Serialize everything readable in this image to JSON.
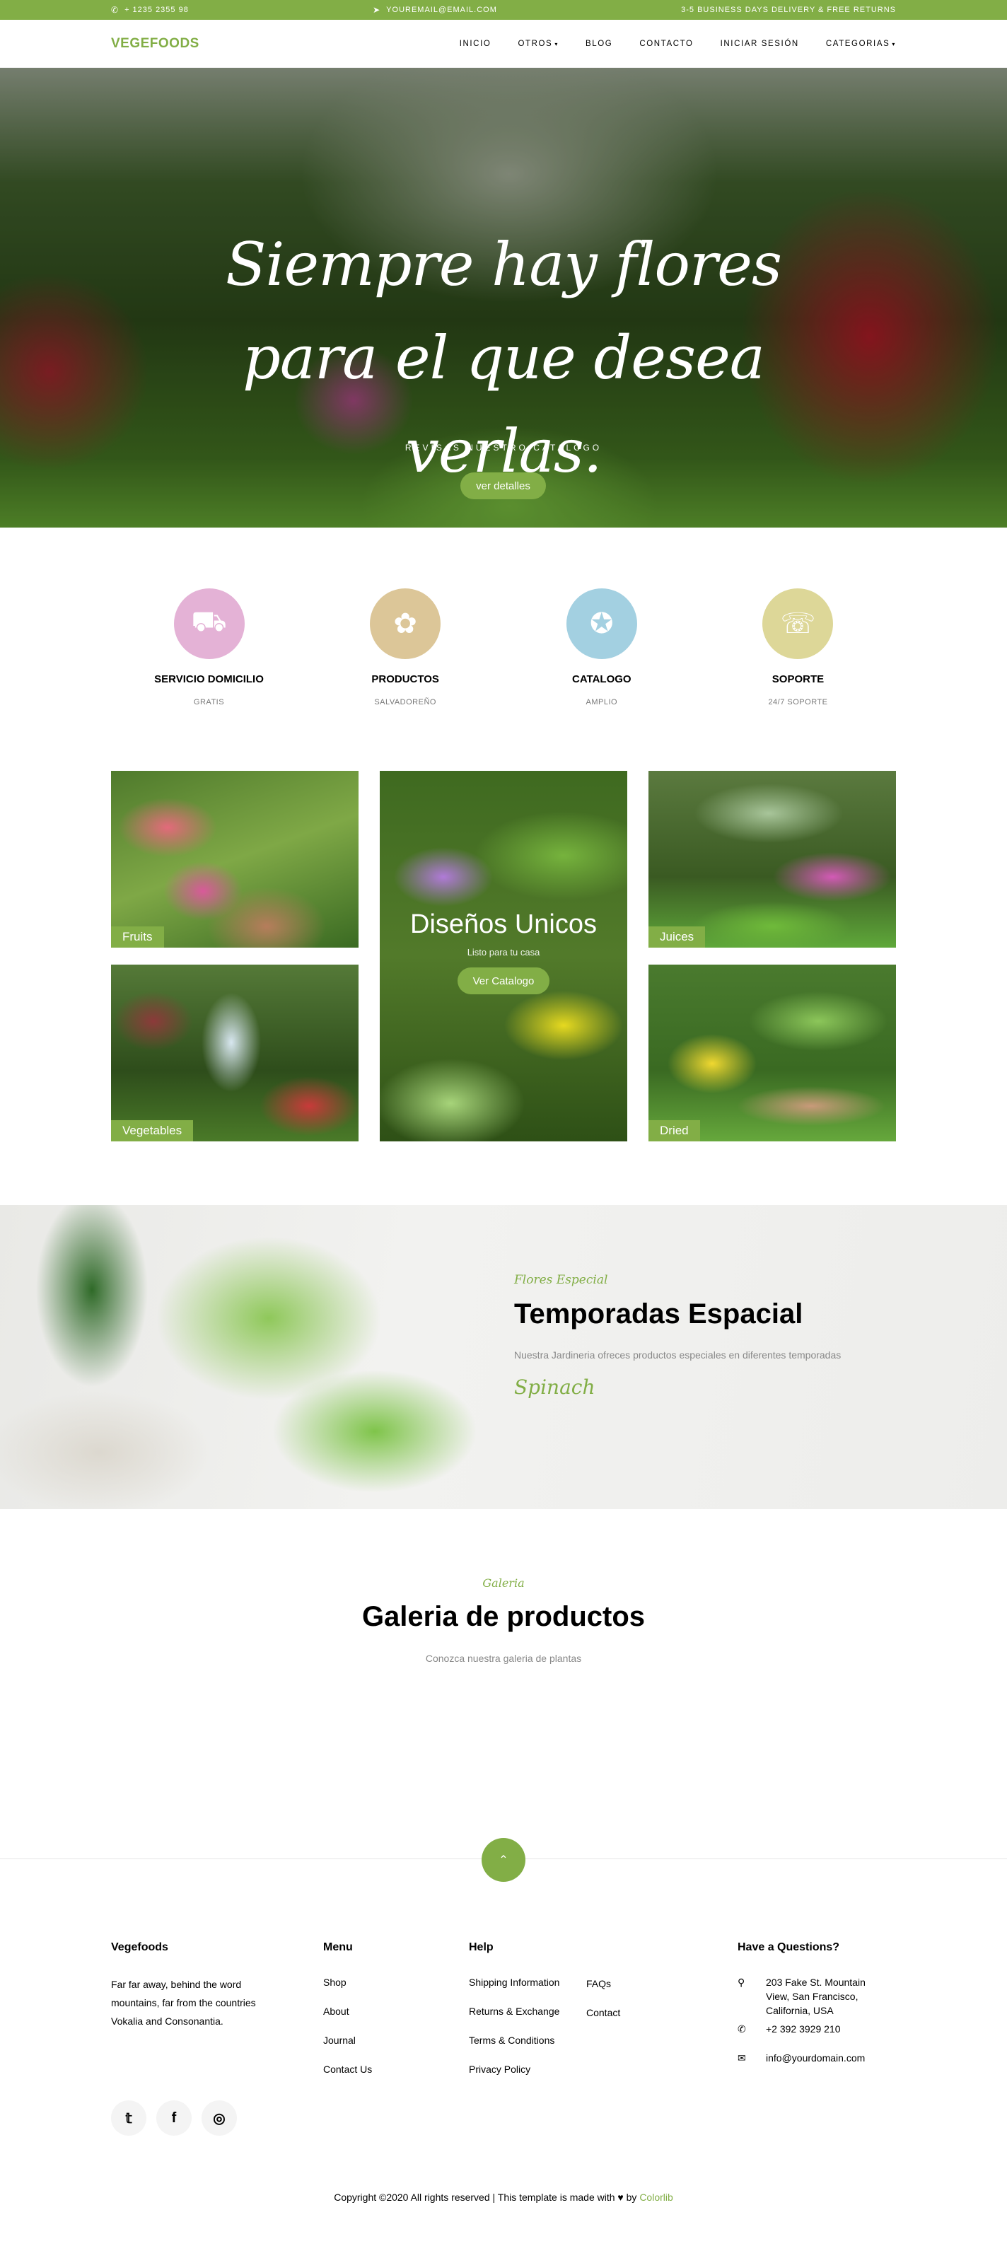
{
  "topbar": {
    "phone": "+ 1235 2355 98",
    "email": "YOUREMAIL@EMAIL.COM",
    "promo": "3-5 BUSINESS DAYS DELIVERY & FREE RETURNS"
  },
  "navbar": {
    "brand": "VEGEFOODS",
    "items": [
      {
        "label": "INICIO",
        "dropdown": false
      },
      {
        "label": "OTROS",
        "dropdown": true
      },
      {
        "label": "BLOG",
        "dropdown": false
      },
      {
        "label": "CONTACTO",
        "dropdown": false
      },
      {
        "label": "INICIAR SESIÓN",
        "dropdown": false
      },
      {
        "label": "CATEGORIAS",
        "dropdown": true
      }
    ]
  },
  "hero": {
    "title": "Siempre hay flores para el que desea verlas.",
    "subtitle": "REVISAS NUESTRO CATALOGO",
    "button": "ver detalles"
  },
  "services": [
    {
      "title": "SERVICIO DOMICILIO",
      "desc": "GRATIS",
      "icon": "truck-icon",
      "color": "#e4b2d6"
    },
    {
      "title": "PRODUCTOS",
      "desc": "SALVADOREÑO",
      "icon": "flower-pot-icon",
      "color": "#dcc698"
    },
    {
      "title": "CATALOGO",
      "desc": "AMPLIO",
      "icon": "award-icon",
      "color": "#a3d0e1"
    },
    {
      "title": "SOPORTE",
      "desc": "24/7 SOPORTE",
      "icon": "support-icon",
      "color": "#ddd798"
    }
  ],
  "categories": {
    "tiles": [
      {
        "label": "Fruits"
      },
      {
        "label": "Juices"
      },
      {
        "label": "Vegetables"
      },
      {
        "label": "Dried"
      }
    ],
    "center": {
      "title": "Diseños Unicos",
      "tagline": "Listo para tu casa",
      "button": "Ver Catalogo"
    }
  },
  "special": {
    "kicker": "Flores Especial",
    "title": "Temporadas Espacial",
    "text": "Nuestra Jardineria ofreces productos especiales en diferentes temporadas",
    "product": "Spinach"
  },
  "gallery": {
    "kicker": "Galeria",
    "title": "Galeria de productos",
    "text": "Conozca nuestra galeria de plantas"
  },
  "footer": {
    "about": {
      "title": "Vegefoods",
      "text": "Far far away, behind the word mountains, far from the countries Vokalia and Consonantia."
    },
    "menu": {
      "title": "Menu",
      "items": [
        "Shop",
        "About",
        "Journal",
        "Contact Us"
      ]
    },
    "help": {
      "title": "Help",
      "col1": [
        "Shipping Information",
        "Returns & Exchange",
        "Terms & Conditions",
        "Privacy Policy"
      ],
      "col2": [
        "FAQs",
        "Contact"
      ]
    },
    "contact": {
      "title": "Have a Questions?",
      "address": "203 Fake St. Mountain View, San Francisco, California, USA",
      "phone": "+2 392 3929 210",
      "email": "info@yourdomain.com"
    },
    "social": [
      "twitter-icon",
      "facebook-icon",
      "instagram-icon"
    ],
    "copyright_prefix": "Copyright ©2020 All rights reserved | This template is made with",
    "copyright_by": "by",
    "copyright_brand": "Colorlib"
  }
}
